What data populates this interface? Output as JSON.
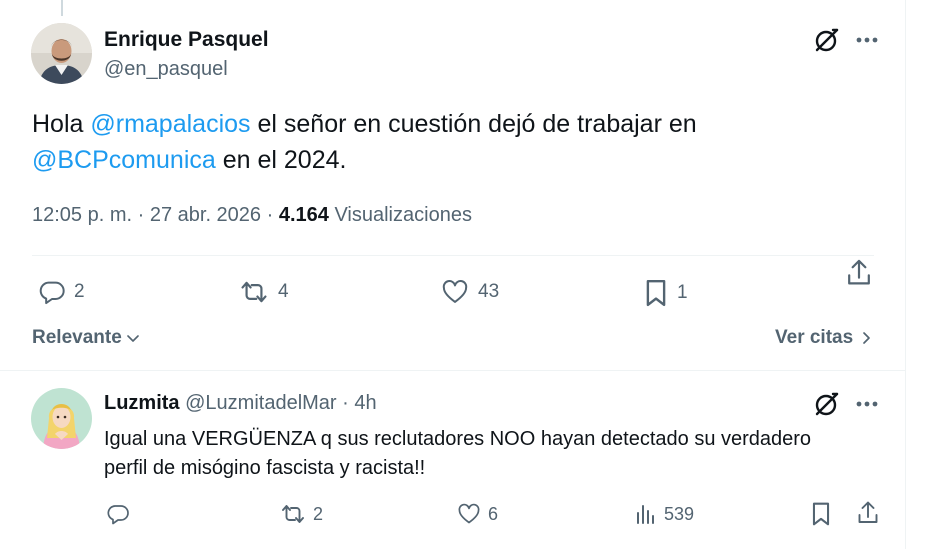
{
  "post": {
    "author_name": "Enrique Pasquel",
    "author_handle": "@en_pasquel",
    "text_before": "Hola ",
    "mention_1": "@rmapalacios",
    "text_middle": " el señor en cuestión dejó de trabajar en ",
    "mention_2": "@BCPcomunica",
    "text_after": " en el 2024.",
    "timestamp": "12:05 p. m. · 27 abr. 2026 · ",
    "views_count": "4.164",
    "views_label": " Visualizaciones",
    "replies": "2",
    "reposts": "4",
    "likes": "43",
    "bookmarks": "1"
  },
  "thread_controls": {
    "sort_label": "Relevante",
    "quotes_label": "Ver citas"
  },
  "reply": {
    "author_name": "Luzmita",
    "author_meta": " @LuzmitadelMar · 4h",
    "text": "Igual una VERGÜENZA q sus reclutadores NOO hayan detectado su verdadero perfil de misógino fascista y racista!!",
    "reposts": "2",
    "likes": "6",
    "views": "539"
  },
  "colors": {
    "link": "#1d9bf0",
    "secondary_text": "#536471",
    "primary_text": "#0f1419",
    "divider": "#eff3f4"
  },
  "icons": [
    "grok-icon",
    "more-icon",
    "reply-icon",
    "repost-icon",
    "like-icon",
    "bookmark-icon",
    "share-icon",
    "views-icon",
    "chevron-down-icon",
    "chevron-right-icon"
  ]
}
